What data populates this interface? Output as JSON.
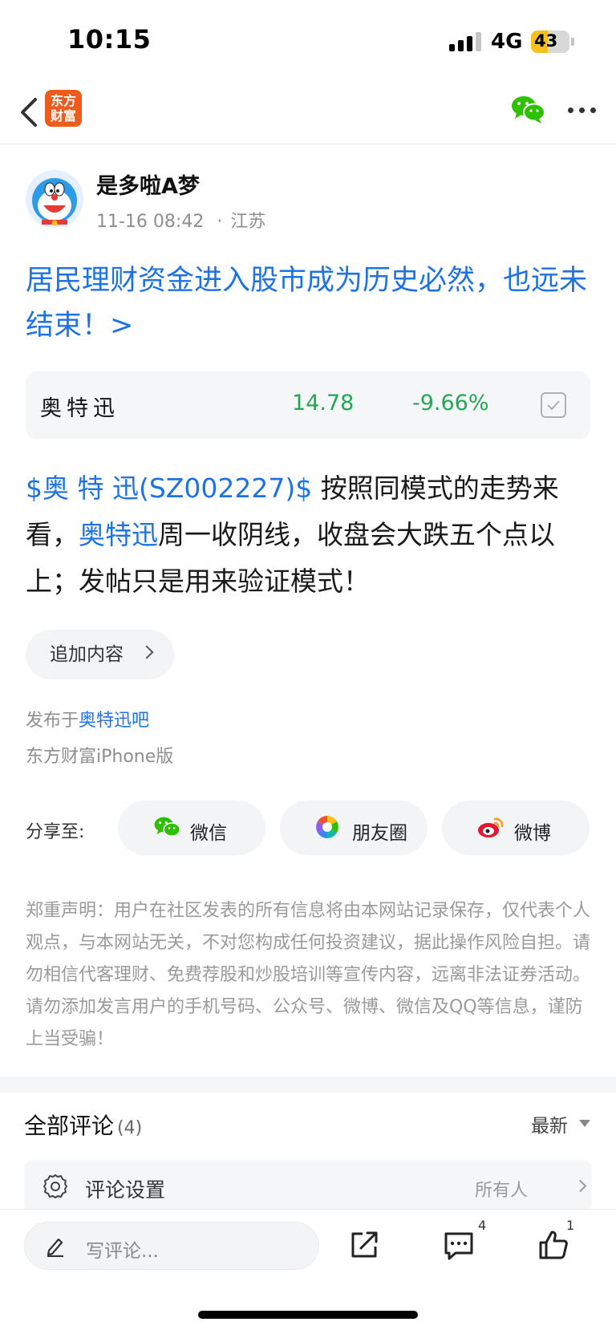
{
  "status_bar": {
    "time": "10:15",
    "network": "4G",
    "battery_level": "43",
    "battery_fraction": 0.43
  },
  "nav": {
    "logo_text_line1": "东方",
    "logo_text_line2": "财富",
    "logo_color": "#ee5b1b",
    "share_icon": "wechat-icon",
    "more_icon": "more-dots-icon"
  },
  "post": {
    "author": "是多啦A梦",
    "date": "11-16 08:42",
    "location": "江苏",
    "title": "居民理财资金进入股市成为历史必然，也远未结束！>",
    "stock_card": {
      "name": "奥特迅",
      "price": "14.78",
      "change": "-9.66%",
      "change_color": "#26a556"
    },
    "body": {
      "stock_tag": "$奥 特 迅(SZ002227)$",
      "text_part1": "  按照同模式的走势来看，",
      "stock_link": "奥特迅",
      "text_part2": "周一收阴线，收盘会大跌五个点以上；发帖只是用来验证模式！"
    },
    "append_label": "追加内容",
    "published_prefix": "发布于",
    "published_forum": "奥特迅吧",
    "client": "东方财富iPhone版"
  },
  "share": {
    "label": "分享至:",
    "options": [
      {
        "label": "微信",
        "icon": "wechat-icon"
      },
      {
        "label": "朋友圈",
        "icon": "moments-icon"
      },
      {
        "label": "微博",
        "icon": "weibo-icon"
      }
    ]
  },
  "disclaimer": "郑重声明：用户在社区发表的所有信息将由本网站记录保存，仅代表个人观点，与本网站无关，不对您构成任何投资建议，据此操作风险自担。请勿相信代客理财、免费荐股和炒股培训等宣传内容，远离非法证券活动。请勿添加发言用户的手机号码、公众号、微博、微信及QQ等信息，谨防上当受骗！",
  "comments": {
    "title": "全部评论",
    "count": "(4)",
    "sort": "最新",
    "settings_label": "评论设置",
    "settings_value": "所有人"
  },
  "bottom_bar": {
    "input_placeholder": "写评论...",
    "comment_count": "4",
    "like_count": "1"
  },
  "colors": {
    "link_blue": "#1d72e5",
    "wechat_green": "#2dc100"
  }
}
